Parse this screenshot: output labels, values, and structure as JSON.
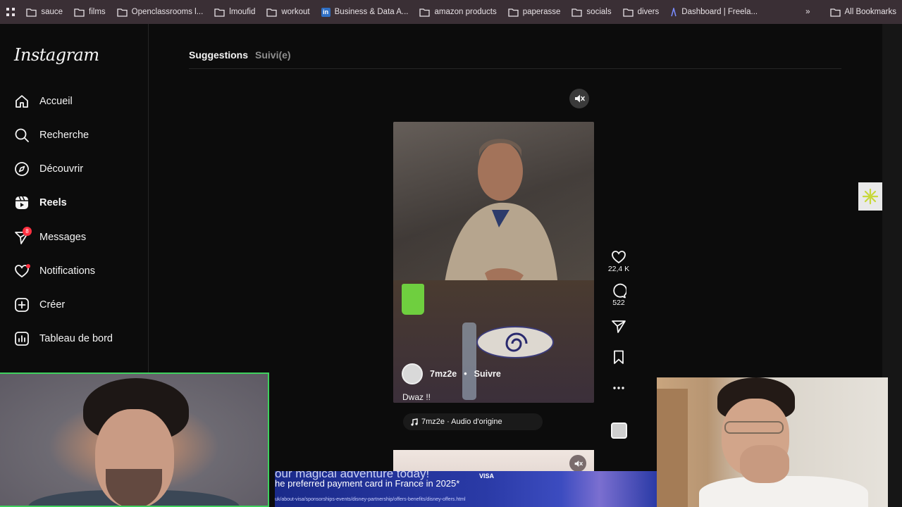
{
  "bookmarks": {
    "items": [
      "sauce",
      "films",
      "Openclassrooms l...",
      "lmoufid",
      "workout",
      "Business & Data A...",
      "amazon products",
      "paperasse",
      "socials",
      "divers",
      "Dashboard | Freela..."
    ],
    "all_bookmarks": "All Bookmarks",
    "overflow": "»"
  },
  "instagram": {
    "logo": "Instagram",
    "nav": {
      "home": "Accueil",
      "search": "Recherche",
      "explore": "Découvrir",
      "reels": "Reels",
      "messages": "Messages",
      "messages_badge": "8",
      "notifications": "Notifications",
      "create": "Créer",
      "dashboard": "Tableau de bord"
    },
    "tabs": {
      "suggestions": "Suggestions",
      "following": "Suivi(e)"
    },
    "reel": {
      "username": "7mz2e",
      "separator": "•",
      "follow": "Suivre",
      "caption": "Dwaz !!",
      "audio": "7mz2e · Audio d'origine",
      "likes": "22,4 K",
      "comments": "522"
    }
  },
  "ad": {
    "line1": "our magical adventure today!",
    "line2": "he preferred payment card in France in 2025*",
    "line3": "uk/about-visa/sponsorships-events/disney-partnership/offers-benefits/disney-offers.html",
    "brand": "VISA"
  },
  "colors": {
    "accent_red": "#ff3040",
    "call_border": "#3fd05e",
    "bookmark_bar": "#3a2f35"
  }
}
